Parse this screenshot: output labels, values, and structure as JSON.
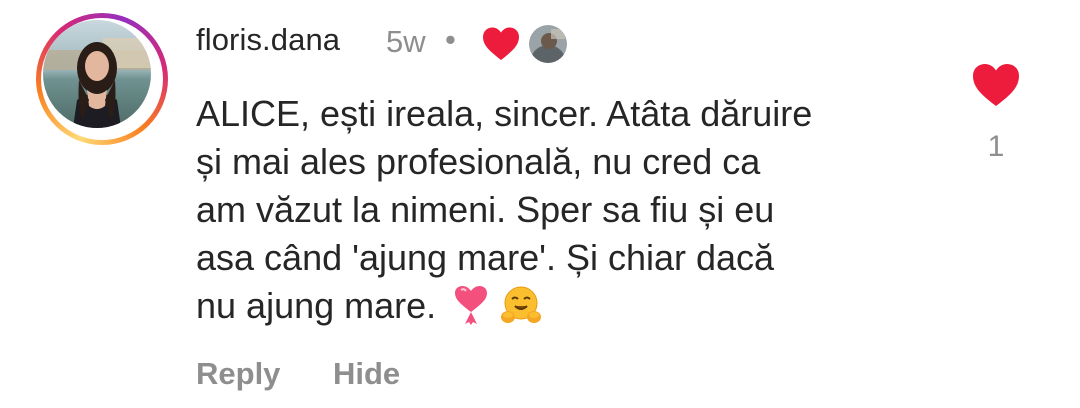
{
  "comment": {
    "username": "floris.dana",
    "time": "5w",
    "separator": "•",
    "text_lines": [
      "ALICE, ești ireala, sincer. Atâta dăruire",
      "și mai ales profesională, nu cred ca",
      "am văzut la nimeni. Sper sa fiu și eu",
      "asa când 'ajung mare'. Și chiar dacă",
      "nu ajung mare."
    ],
    "trailing_emojis": [
      "heart-with-ribbon-emoji",
      "hugging-face-emoji"
    ],
    "like_count": "1",
    "liked_by_creator": true
  },
  "actions": {
    "reply_label": "Reply",
    "hide_label": "Hide"
  },
  "colors": {
    "text": "#262626",
    "muted": "#8e8e8e",
    "like_red": "#ed1c3d",
    "story_ring": [
      "#feda75",
      "#fa7e1e",
      "#d62976",
      "#962fbf"
    ]
  }
}
